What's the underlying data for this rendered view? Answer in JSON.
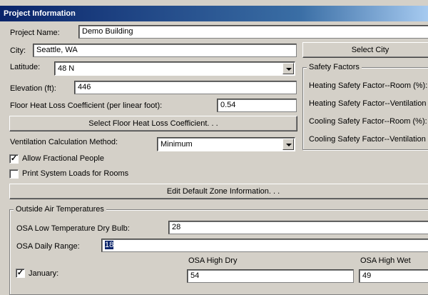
{
  "window": {
    "title": "Project Information"
  },
  "project_name": {
    "label": "Project Name:",
    "value": "Demo Building"
  },
  "city": {
    "label": "City:",
    "value": "Seattle, WA",
    "select_label": "Select City"
  },
  "latitude": {
    "label": "Latitude:",
    "value": "48 N"
  },
  "elevation": {
    "label": "Elevation (ft):",
    "value": "446"
  },
  "floor_heat_loss": {
    "label": "Floor Heat Loss Coefficient (per linear foot):",
    "value": "0.54",
    "select_label": "Select Floor Heat Loss Coefficient. . ."
  },
  "ventilation": {
    "label": "Ventilation Calculation Method:",
    "value": "Minimum"
  },
  "checkboxes": {
    "fractional_people": {
      "label": "Allow Fractional People",
      "checked": true
    },
    "print_room_loads": {
      "label": "Print System Loads for Rooms",
      "checked": false
    }
  },
  "safety_factors": {
    "legend": "Safety Factors",
    "items": [
      "Heating Safety Factor--Room (%):",
      "Heating Safety Factor--Ventilation (%",
      "Cooling Safety Factor--Room (%):",
      "Cooling Safety Factor--Ventilation (%"
    ]
  },
  "edit_zone_button": "Edit Default Zone Information. . .",
  "outside_air": {
    "legend": "Outside Air Temperatures",
    "low_temp": {
      "label": "OSA Low Temperature Dry Bulb:",
      "value": "28"
    },
    "daily_range": {
      "label": "OSA Daily Range:",
      "value": "18"
    },
    "col_high_dry": "OSA High Dry",
    "col_high_wet": "OSA High Wet",
    "months": [
      {
        "label": "January:",
        "checked": true,
        "high_dry": "54",
        "high_wet": "49"
      }
    ]
  }
}
